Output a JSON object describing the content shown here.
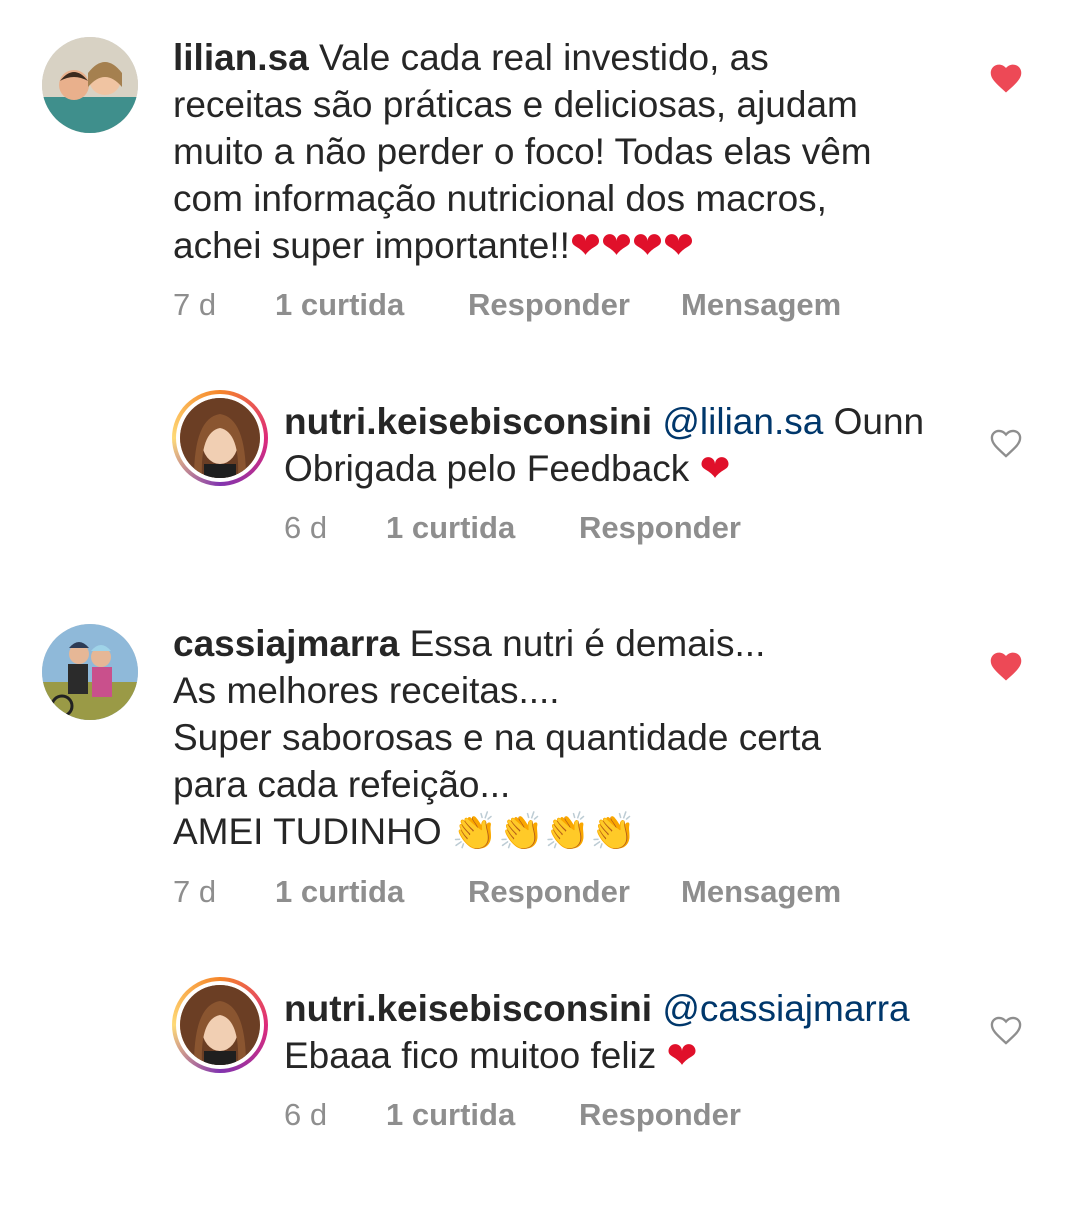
{
  "comments": [
    {
      "username": "lilian.sa",
      "text": "Vale cada real investido, as\nreceitas são práticas e deliciosas, ajudam\nmuito a não perder o foco! Todas elas vêm\ncom informação nutricional dos macros,\nachei super importante!!",
      "emoji": "❤❤❤❤",
      "time": "7 d",
      "likes": "1 curtida",
      "reply": "Responder",
      "message": "Mensagem",
      "liked": true
    },
    {
      "username": "nutri.keisebisconsini",
      "mention": "@lilian.sa",
      "text": "Ounn\nObrigada pelo Feedback",
      "emoji": "❤",
      "time": "6 d",
      "likes": "1 curtida",
      "reply": "Responder",
      "liked": false
    },
    {
      "username": "cassiajmarra",
      "text": "Essa nutri é demais...\nAs melhores receitas....\nSuper saborosas e na quantidade certa\npara cada refeição...\nAMEI TUDINHO",
      "emoji": "👏👏👏👏",
      "time": "7 d",
      "likes": "1 curtida",
      "reply": "Responder",
      "message": "Mensagem",
      "liked": true
    },
    {
      "username": "nutri.keisebisconsini",
      "mention": "@cassiajmarra",
      "text": "Ebaaa fico muitoo feliz",
      "emoji": "❤",
      "time": "6 d",
      "likes": "1 curtida",
      "reply": "Responder",
      "liked": false
    }
  ],
  "colors": {
    "liked_heart": "#ed4956",
    "unliked_heart": "#8e8e8e",
    "mention": "#00376b",
    "meta": "#8e8e8e"
  }
}
